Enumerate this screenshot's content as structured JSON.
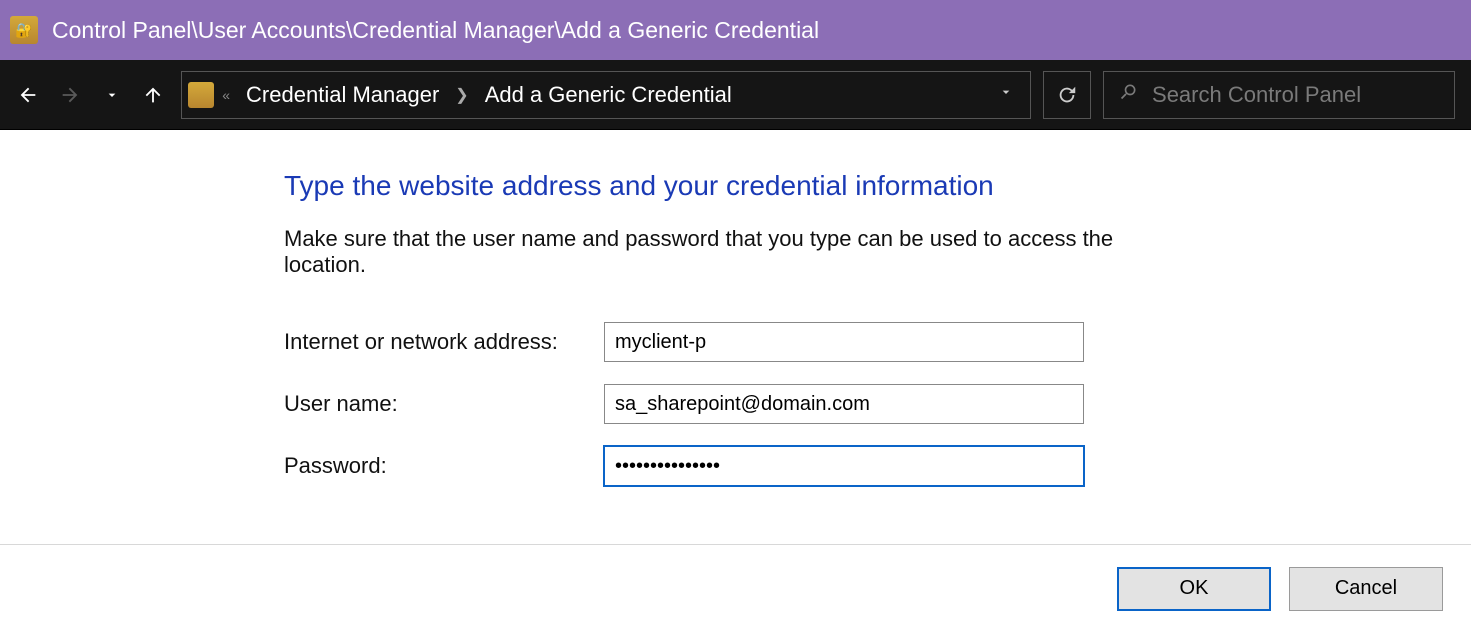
{
  "title": "Control Panel\\User Accounts\\Credential Manager\\Add a Generic Credential",
  "breadcrumb": {
    "items": [
      "Credential Manager",
      "Add a Generic Credential"
    ]
  },
  "search": {
    "placeholder": "Search Control Panel"
  },
  "page": {
    "heading": "Type the website address and your credential information",
    "instruction": "Make sure that the user name and password that you type can be used to access the location.",
    "fields": {
      "address_label": "Internet or network address:",
      "address_value": "myclient-p",
      "username_label": "User name:",
      "username_value": "sa_sharepoint@domain.com",
      "password_label": "Password:",
      "password_value": "•••••••••••••••"
    }
  },
  "buttons": {
    "ok": "OK",
    "cancel": "Cancel"
  }
}
